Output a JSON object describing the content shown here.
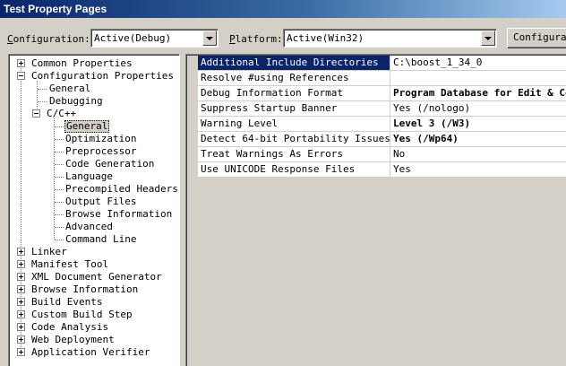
{
  "window": {
    "title": "Test Property Pages"
  },
  "toolbar": {
    "configuration_label_prefix": "C",
    "configuration_label_rest": "onfiguration:",
    "configuration_value": "Active(Debug)",
    "platform_label_prefix": "P",
    "platform_label_rest": "latform:",
    "platform_value": "Active(Win32)",
    "config_manager_label": "Configuration Manager..."
  },
  "tree": {
    "nodes": [
      {
        "label": "Common Properties",
        "expander": "plus"
      },
      {
        "label": "Configuration Properties",
        "expander": "minus"
      },
      {
        "label": "General"
      },
      {
        "label": "Debugging"
      },
      {
        "label": "C/C++",
        "expander": "minus"
      },
      {
        "label": "General",
        "selected": true
      },
      {
        "label": "Optimization"
      },
      {
        "label": "Preprocessor"
      },
      {
        "label": "Code Generation"
      },
      {
        "label": "Language"
      },
      {
        "label": "Precompiled Headers"
      },
      {
        "label": "Output Files"
      },
      {
        "label": "Browse Information"
      },
      {
        "label": "Advanced"
      },
      {
        "label": "Command Line"
      },
      {
        "label": "Linker",
        "expander": "plus"
      },
      {
        "label": "Manifest Tool",
        "expander": "plus"
      },
      {
        "label": "XML Document Generator",
        "expander": "plus"
      },
      {
        "label": "Browse Information",
        "expander": "plus"
      },
      {
        "label": "Build Events",
        "expander": "plus"
      },
      {
        "label": "Custom Build Step",
        "expander": "plus"
      },
      {
        "label": "Code Analysis",
        "expander": "plus"
      },
      {
        "label": "Web Deployment",
        "expander": "plus"
      },
      {
        "label": "Application Verifier",
        "expander": "plus"
      }
    ]
  },
  "properties": [
    {
      "name": "Additional Include Directories",
      "value": "C:\\boost_1_34_0",
      "bold": false,
      "selected": true
    },
    {
      "name": "Resolve #using References",
      "value": "",
      "bold": false
    },
    {
      "name": "Debug Information Format",
      "value": "Program Database for Edit & Continue (/ZI)",
      "bold": true
    },
    {
      "name": "Suppress Startup Banner",
      "value": "Yes (/nologo)",
      "bold": false
    },
    {
      "name": "Warning Level",
      "value": "Level 3 (/W3)",
      "bold": true
    },
    {
      "name": "Detect 64-bit Portability Issues",
      "value": "Yes (/Wp64)",
      "bold": true
    },
    {
      "name": "Treat Warnings As Errors",
      "value": "No",
      "bold": false
    },
    {
      "name": "Use UNICODE Response Files",
      "value": "Yes",
      "bold": false
    }
  ]
}
